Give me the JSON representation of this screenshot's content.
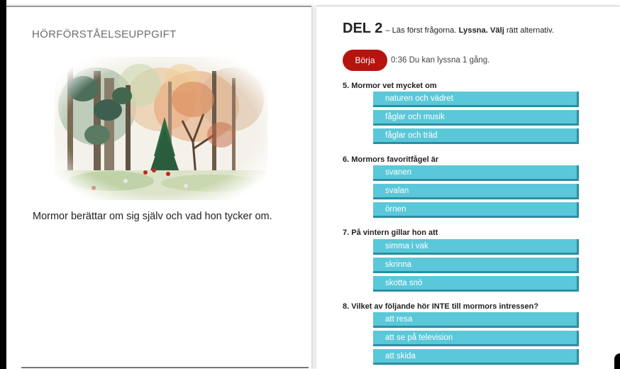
{
  "left_page": {
    "section_label": "HÖRFÖRSTÅELSEUPPGIFT",
    "image_icon": "forest-watercolor-illustration",
    "story_text": "Mormor berättar om sig själv och vad hon tycker om."
  },
  "right_page": {
    "heading": "DEL 2",
    "dash": "–",
    "instr_1": "Läs först frågorna.",
    "instr_2": "Lyssna.",
    "instr_3": "Välj",
    "instr_4": "rätt alternativ.",
    "start_button": "Börja",
    "audio_status": "0:36 Du kan lyssna 1 gång."
  },
  "questions": [
    {
      "text": "5. Mormor vet mycket om",
      "options": [
        "naturen och vädret",
        "fåglar och musik",
        "fåglar och träd"
      ]
    },
    {
      "text": "6. Mormors favoritfågel är",
      "options": [
        "svanen",
        "svalan",
        "örnen"
      ]
    },
    {
      "text": "7. På vintern gillar hon att",
      "options": [
        "simma i vak",
        "skrinna",
        "skotta snö"
      ]
    },
    {
      "text": "8. Vilket av följande hör INTE till mormors intressen?",
      "options": [
        "att resa",
        "att se på television",
        "att skida"
      ]
    }
  ],
  "colors": {
    "start_button": "#b5140f",
    "option_fill": "#5ac8d9",
    "option_shadow": "#2b8fa4"
  }
}
